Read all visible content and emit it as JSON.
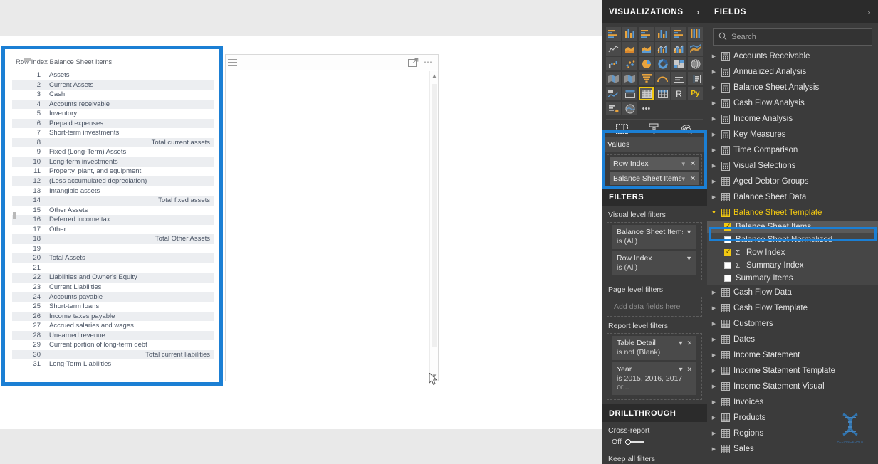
{
  "canvas": {
    "table_visual": {
      "columns": [
        "Row Index",
        "Balance Sheet Items"
      ],
      "rows": [
        {
          "index": "1",
          "item": "Assets",
          "indent": 0,
          "align": "left"
        },
        {
          "index": "2",
          "item": "Current Assets",
          "indent": 1,
          "align": "left"
        },
        {
          "index": "3",
          "item": "Cash",
          "indent": 2,
          "align": "left"
        },
        {
          "index": "4",
          "item": "Accounts receivable",
          "indent": 2,
          "align": "left"
        },
        {
          "index": "5",
          "item": "Inventory",
          "indent": 2,
          "align": "left"
        },
        {
          "index": "6",
          "item": "Prepaid expenses",
          "indent": 2,
          "align": "left"
        },
        {
          "index": "7",
          "item": "Short-term investments",
          "indent": 2,
          "align": "left"
        },
        {
          "index": "8",
          "item": "Total current assets",
          "indent": 0,
          "align": "right"
        },
        {
          "index": "9",
          "item": "Fixed (Long-Term) Assets",
          "indent": 1,
          "align": "left"
        },
        {
          "index": "10",
          "item": "Long-term investments",
          "indent": 2,
          "align": "left"
        },
        {
          "index": "11",
          "item": "Property, plant, and equipment",
          "indent": 2,
          "align": "left"
        },
        {
          "index": "12",
          "item": "(Less accumulated depreciation)",
          "indent": 2,
          "align": "left"
        },
        {
          "index": "13",
          "item": "Intangible assets",
          "indent": 2,
          "align": "left"
        },
        {
          "index": "14",
          "item": "Total fixed assets",
          "indent": 0,
          "align": "right"
        },
        {
          "index": "15",
          "item": "Other Assets",
          "indent": 1,
          "align": "left"
        },
        {
          "index": "16",
          "item": "Deferred income tax",
          "indent": 2,
          "align": "left"
        },
        {
          "index": "17",
          "item": "Other",
          "indent": 2,
          "align": "left"
        },
        {
          "index": "18",
          "item": "Total Other Assets",
          "indent": 0,
          "align": "right"
        },
        {
          "index": "19",
          "item": "",
          "indent": 0,
          "align": "left"
        },
        {
          "index": "20",
          "item": "Total Assets",
          "indent": 1,
          "align": "left"
        },
        {
          "index": "21",
          "item": "",
          "indent": 0,
          "align": "left"
        },
        {
          "index": "22",
          "item": "Liabilities and Owner's Equity",
          "indent": 0,
          "align": "left"
        },
        {
          "index": "23",
          "item": "Current Liabilities",
          "indent": 1,
          "align": "left"
        },
        {
          "index": "24",
          "item": "Accounts payable",
          "indent": 1,
          "align": "left"
        },
        {
          "index": "25",
          "item": "Short-term loans",
          "indent": 1,
          "align": "left"
        },
        {
          "index": "26",
          "item": "Income taxes payable",
          "indent": 1,
          "align": "left"
        },
        {
          "index": "27",
          "item": "Accrued salaries and wages",
          "indent": 1,
          "align": "left"
        },
        {
          "index": "28",
          "item": "Unearned revenue",
          "indent": 1,
          "align": "left"
        },
        {
          "index": "29",
          "item": "Current portion of long-term debt",
          "indent": 1,
          "align": "left"
        },
        {
          "index": "30",
          "item": "Total current liabilities",
          "indent": 0,
          "align": "right"
        },
        {
          "index": "31",
          "item": "Long-Term Liabilities",
          "indent": 0,
          "align": "left"
        }
      ]
    },
    "empty_visual": {
      "focus_icon": "focus-mode-icon",
      "more_icon": "more-options-icon"
    },
    "cursor": "mouse-cursor"
  },
  "visualizations": {
    "title": "VISUALIZATIONS",
    "expand_icon": "chevron-right-icon",
    "gallery": [
      {
        "name": "stacked-bar-chart",
        "selected": false
      },
      {
        "name": "stacked-column-chart",
        "selected": false
      },
      {
        "name": "clustered-bar-chart",
        "selected": false
      },
      {
        "name": "clustered-column-chart",
        "selected": false
      },
      {
        "name": "100-percent-stacked-bar-chart",
        "selected": false
      },
      {
        "name": "100-percent-stacked-column-chart",
        "selected": false
      },
      {
        "name": "line-chart",
        "selected": false
      },
      {
        "name": "area-chart",
        "selected": false
      },
      {
        "name": "stacked-area-chart",
        "selected": false
      },
      {
        "name": "line-and-stacked-column-chart",
        "selected": false
      },
      {
        "name": "line-and-clustered-column-chart",
        "selected": false
      },
      {
        "name": "ribbon-chart",
        "selected": false
      },
      {
        "name": "waterfall-chart",
        "selected": false
      },
      {
        "name": "scatter-chart",
        "selected": false
      },
      {
        "name": "pie-chart",
        "selected": false
      },
      {
        "name": "donut-chart",
        "selected": false
      },
      {
        "name": "treemap",
        "selected": false
      },
      {
        "name": "map",
        "selected": false
      },
      {
        "name": "filled-map",
        "selected": false
      },
      {
        "name": "shape-map",
        "selected": false
      },
      {
        "name": "funnel-chart",
        "selected": false
      },
      {
        "name": "gauge-chart",
        "selected": false
      },
      {
        "name": "card",
        "selected": false
      },
      {
        "name": "multi-row-card",
        "selected": false
      },
      {
        "name": "kpi",
        "selected": false
      },
      {
        "name": "slicer",
        "selected": false
      },
      {
        "name": "table",
        "selected": true
      },
      {
        "name": "matrix",
        "selected": false
      },
      {
        "name": "r-script-visual",
        "selected": false,
        "label": "R"
      },
      {
        "name": "python-visual",
        "selected": false,
        "label": "Py"
      },
      {
        "name": "key-influencers",
        "selected": false
      },
      {
        "name": "arcgis-maps",
        "selected": false
      },
      {
        "name": "get-more-visuals",
        "selected": false,
        "label": "•••"
      }
    ],
    "tabs": [
      {
        "name": "fields-tab",
        "icon": "fields-grid-icon"
      },
      {
        "name": "format-tab",
        "icon": "paint-roller-icon"
      },
      {
        "name": "analytics-tab",
        "icon": "analytics-magnifier-icon"
      }
    ],
    "values": {
      "header": "Values",
      "fields": [
        {
          "label": "Row Index",
          "dropdown_icon": "chevron-down-icon",
          "remove_icon": "close-icon"
        },
        {
          "label": "Balance Sheet Items",
          "dropdown_icon": "chevron-down-icon",
          "remove_icon": "close-icon"
        }
      ]
    },
    "filters": {
      "title": "FILTERS",
      "visual_level_label": "Visual level filters",
      "visual_level": [
        {
          "field": "Balance Sheet Items",
          "condition": "is (All)",
          "expand_icon": "chevron-down-icon"
        },
        {
          "field": "Row Index",
          "condition": "is (All)",
          "expand_icon": "chevron-down-icon"
        }
      ],
      "page_level_label": "Page level filters",
      "page_level_placeholder": "Add data fields here",
      "report_level_label": "Report level filters",
      "report_level": [
        {
          "field": "Table Detail",
          "condition": "is not (Blank)",
          "expand_icon": "chevron-down-icon",
          "remove_icon": "close-icon"
        },
        {
          "field": "Year",
          "condition": "is 2015, 2016, 2017 or...",
          "expand_icon": "chevron-down-icon",
          "remove_icon": "close-icon"
        }
      ]
    },
    "drillthrough": {
      "title": "DRILLTHROUGH",
      "cross_report_label": "Cross-report",
      "toggle_state": "Off",
      "keep_all_filters_label": "Keep all filters"
    }
  },
  "fields": {
    "title": "FIELDS",
    "expand_icon": "chevron-right-icon",
    "search_placeholder": "Search",
    "search_icon": "search-icon",
    "tables": [
      {
        "label": "Accounts Receivable",
        "icon": "measure-table-icon",
        "expanded": false
      },
      {
        "label": "Annualized Analysis",
        "icon": "measure-table-icon",
        "expanded": false
      },
      {
        "label": "Balance Sheet Analysis",
        "icon": "measure-table-icon",
        "expanded": false
      },
      {
        "label": "Cash Flow Analysis",
        "icon": "measure-table-icon",
        "expanded": false
      },
      {
        "label": "Income Analysis",
        "icon": "measure-table-icon",
        "expanded": false
      },
      {
        "label": "Key Measures",
        "icon": "measure-table-icon",
        "expanded": false
      },
      {
        "label": "Time Comparison",
        "icon": "measure-table-icon",
        "expanded": false
      },
      {
        "label": "Visual Selections",
        "icon": "measure-table-icon",
        "expanded": false
      },
      {
        "label": "Aged Debtor Groups",
        "icon": "data-table-icon",
        "expanded": false
      },
      {
        "label": "Balance Sheet Data",
        "icon": "data-table-icon",
        "expanded": false
      },
      {
        "label": "Balance Sheet Template",
        "icon": "data-table-icon",
        "expanded": true
      },
      {
        "label": "Cash Flow Data",
        "icon": "data-table-icon",
        "expanded": false
      },
      {
        "label": "Cash Flow Template",
        "icon": "data-table-icon",
        "expanded": false
      },
      {
        "label": "Customers",
        "icon": "data-table-icon",
        "expanded": false
      },
      {
        "label": "Dates",
        "icon": "data-table-icon",
        "expanded": false
      },
      {
        "label": "Income Statement",
        "icon": "data-table-icon",
        "expanded": false
      },
      {
        "label": "Income Statement Template",
        "icon": "data-table-icon",
        "expanded": false
      },
      {
        "label": "Income Statement Visual",
        "icon": "data-table-icon",
        "expanded": false
      },
      {
        "label": "Invoices",
        "icon": "data-table-icon",
        "expanded": false
      },
      {
        "label": "Products",
        "icon": "data-table-icon",
        "expanded": false
      },
      {
        "label": "Regions",
        "icon": "data-table-icon",
        "expanded": false
      },
      {
        "label": "Sales",
        "icon": "data-table-icon",
        "expanded": false
      }
    ],
    "expanded_table_fields": [
      {
        "label": "Balance Sheet Items",
        "checked": true,
        "sigma": false,
        "highlighted": true
      },
      {
        "label": "Balance Sheet Normalized",
        "checked": false,
        "sigma": false,
        "highlighted": false
      },
      {
        "label": "Row Index",
        "checked": true,
        "sigma": true,
        "highlighted": false
      },
      {
        "label": "Summary Index",
        "checked": false,
        "sigma": true,
        "highlighted": false
      },
      {
        "label": "Summary Items",
        "checked": false,
        "sigma": false,
        "highlighted": false
      }
    ],
    "watermark": {
      "name": "dna-logo-watermark",
      "text": "ALLIANCEDATA"
    }
  },
  "colors": {
    "selection_blue": "#1b7fd4",
    "accent_yellow": "#f2c811",
    "panel_bg": "#3b3b3b",
    "panel_header_bg": "#2b2b2b"
  }
}
